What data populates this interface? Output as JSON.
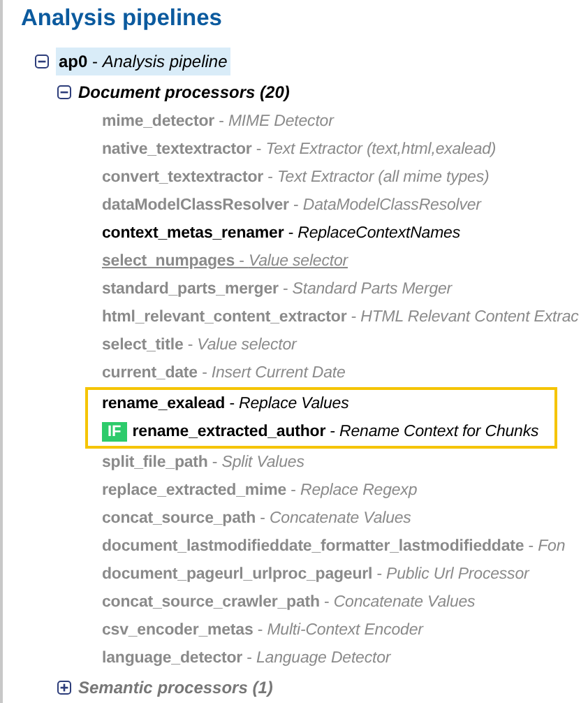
{
  "title": "Analysis pipelines",
  "pipeline": {
    "label": "**ap0** - *Analysis pipeline*",
    "expanded": true,
    "selected": true,
    "groups": [
      {
        "label": "Document processors (20)",
        "expanded": true,
        "items": [
          {
            "kind": "item",
            "label": "**mime_detector** - *MIME Detector*",
            "enabled": false,
            "underlined": false
          },
          {
            "kind": "item",
            "label": "**native_textextractor** - *Text Extractor (text,html,exalead)*",
            "enabled": false,
            "underlined": false
          },
          {
            "kind": "item",
            "label": "**convert_textextractor** - *Text Extractor (all mime types)*",
            "enabled": false,
            "underlined": false
          },
          {
            "kind": "item",
            "label": "**dataModelClassResolver** - *DataModelClassResolver*",
            "enabled": false,
            "underlined": false
          },
          {
            "kind": "item",
            "label": "**context_metas_renamer** - *ReplaceContextNames*",
            "enabled": true,
            "underlined": false
          },
          {
            "kind": "item",
            "label": "**select_numpages** - *Value selector*",
            "enabled": false,
            "underlined": true
          },
          {
            "kind": "item",
            "label": "**standard_parts_merger** - *Standard Parts Merger*",
            "enabled": false,
            "underlined": false
          },
          {
            "kind": "item",
            "label": "**html_relevant_content_extractor** - *HTML Relevant Content Extrac*",
            "enabled": false,
            "underlined": false
          },
          {
            "kind": "item",
            "label": "**select_title** - *Value selector*",
            "enabled": false,
            "underlined": false
          },
          {
            "kind": "item",
            "label": "**current_date** - *Insert Current Date*",
            "enabled": false,
            "underlined": false
          },
          {
            "kind": "highlight",
            "items": [
              {
                "kind": "item",
                "label": "**rename_exalead** - *Replace Values*",
                "enabled": true,
                "underlined": false
              },
              {
                "kind": "item",
                "label": "**rename_extracted_author** - *Rename Context for Chunks*",
                "enabled": true,
                "underlined": false,
                "badge": "IF"
              }
            ]
          },
          {
            "kind": "item",
            "label": "**split_file_path** - *Split Values*",
            "enabled": false,
            "underlined": false
          },
          {
            "kind": "item",
            "label": "**replace_extracted_mime** - *Replace Regexp*",
            "enabled": false,
            "underlined": false
          },
          {
            "kind": "item",
            "label": "**concat_source_path** - *Concatenate Values*",
            "enabled": false,
            "underlined": false
          },
          {
            "kind": "item",
            "label": "**document_lastmodifieddate_formatter_lastmodifieddate** - *Fon*",
            "enabled": false,
            "underlined": false
          },
          {
            "kind": "item",
            "label": "**document_pageurl_urlproc_pageurl** - *Public Url Processor*",
            "enabled": false,
            "underlined": false
          },
          {
            "kind": "item",
            "label": "**concat_source_crawler_path** - *Concatenate Values*",
            "enabled": false,
            "underlined": false
          },
          {
            "kind": "item",
            "label": "**csv_encoder_metas** - *Multi-Context Encoder*",
            "enabled": false,
            "underlined": false
          },
          {
            "kind": "item",
            "label": "**language_detector** - *Language Detector*",
            "enabled": false,
            "underlined": false
          }
        ]
      },
      {
        "label": "Semantic processors (1)",
        "expanded": false
      }
    ]
  }
}
